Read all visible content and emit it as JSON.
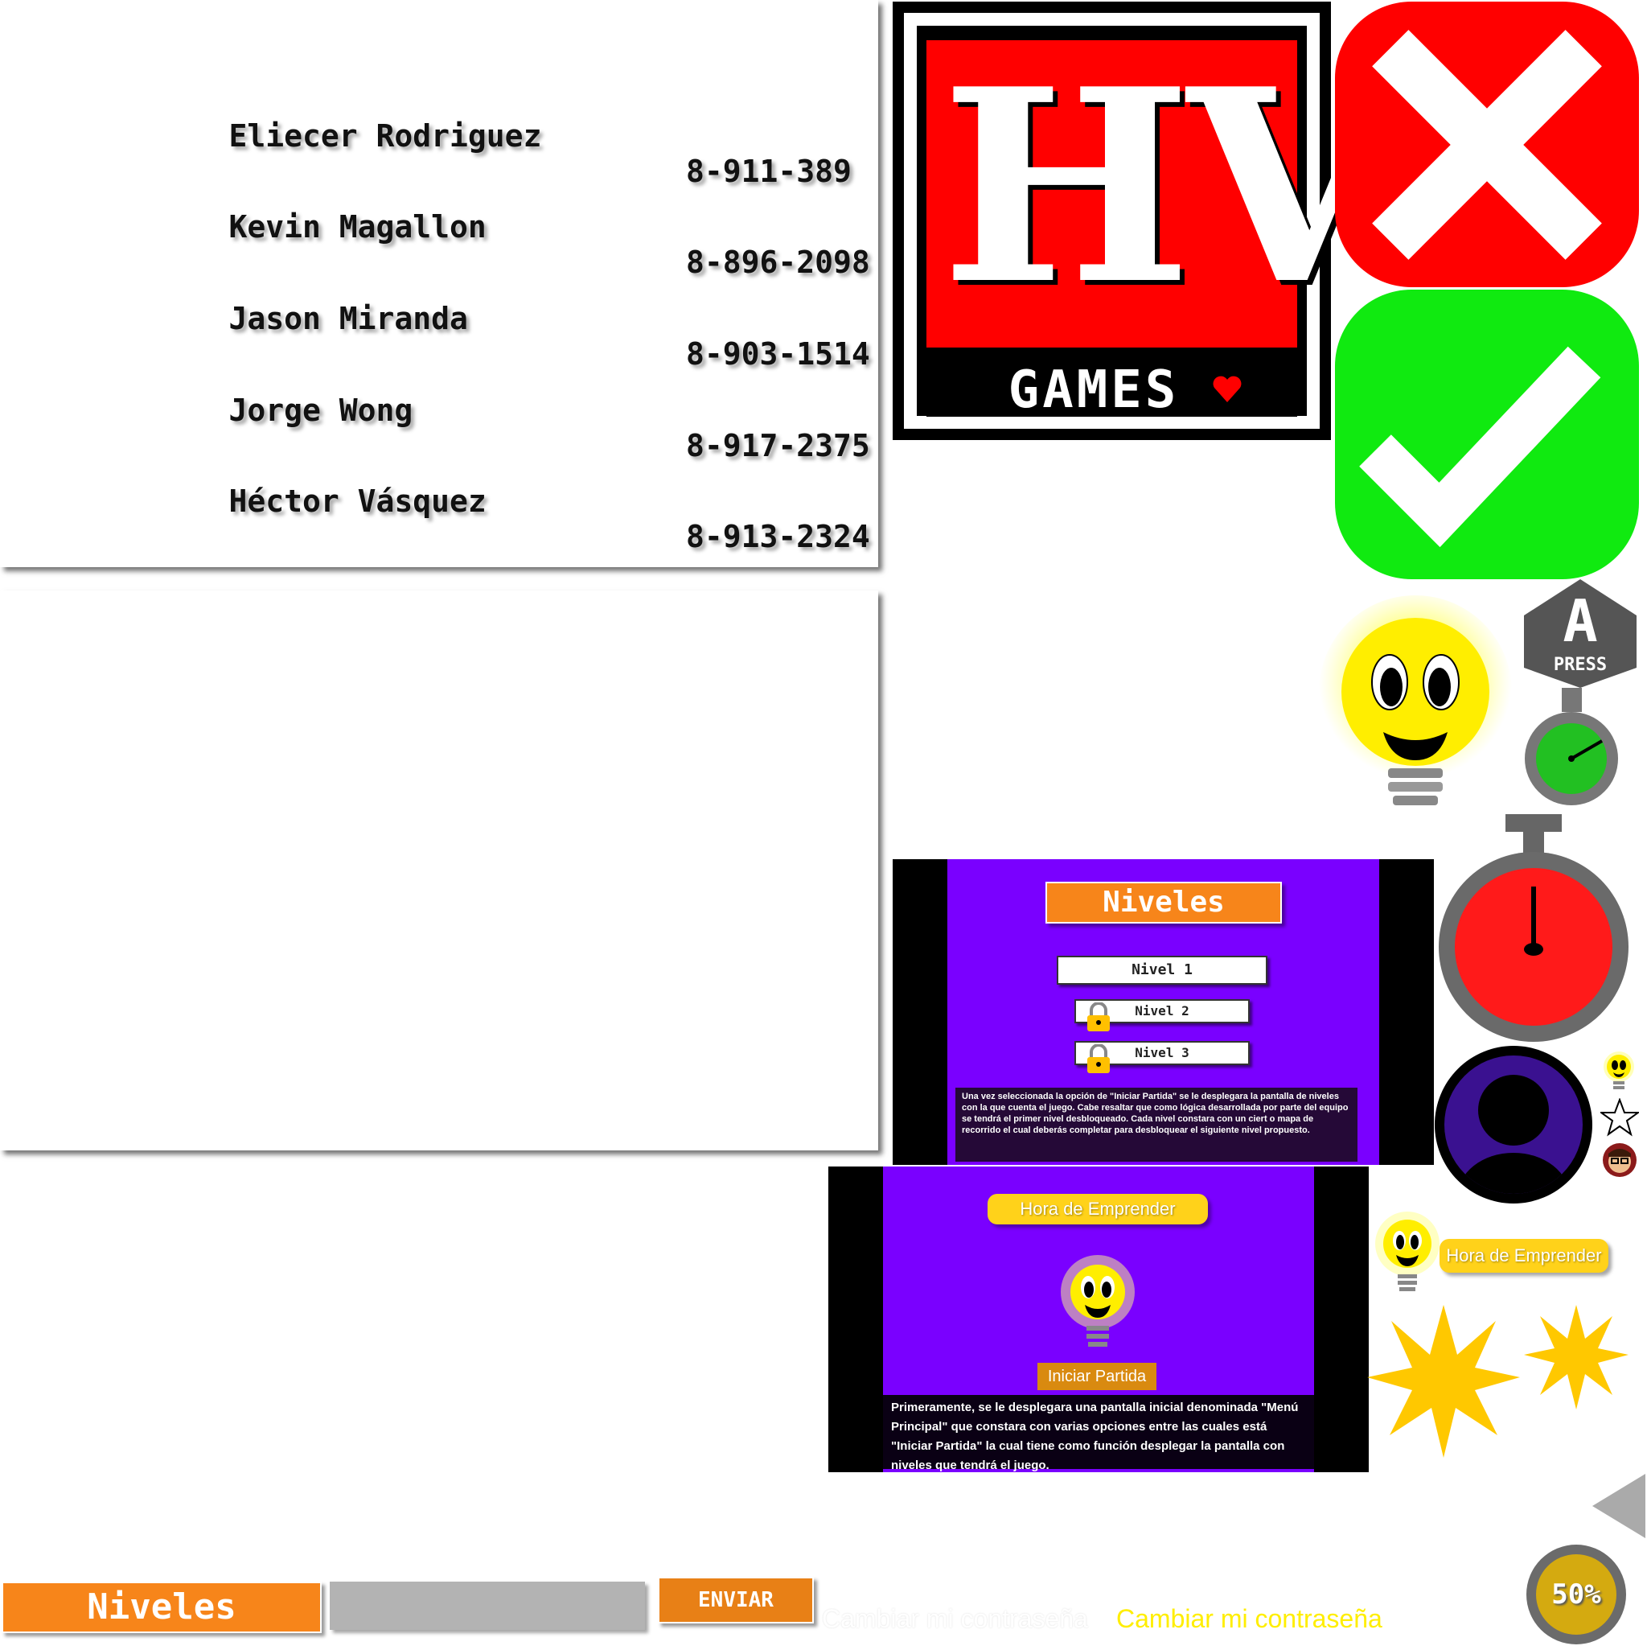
{
  "credits": [
    {
      "name": "Eliecer Rodriguez",
      "id": "8-911-389"
    },
    {
      "name": "Kevin Magallon",
      "id": "8-896-2098"
    },
    {
      "name": "Jason Miranda",
      "id": "8-903-1514"
    },
    {
      "name": "Jorge Wong",
      "id": "8-917-2375"
    },
    {
      "name": "Héctor Vásquez",
      "id": "8-913-2324"
    }
  ],
  "logo": {
    "letters": "HV",
    "subtitle": "GAMES"
  },
  "press_badge": {
    "letter": "A",
    "label": "PRESS"
  },
  "levels_screen": {
    "title": "Niveles",
    "levels": [
      "Nivel 1",
      "Nivel 2",
      "Nivel 3"
    ],
    "caption": "Una vez seleccionada la opción de \"Iniciar Partida\" se le desplegara la pantalla de niveles con la que cuenta el juego. Cabe resaltar que como lógica desarrollada por parte del equipo se tendrá el primer nivel desbloqueado. Cada nivel  constara con un ciert o mapa de recorrido el cual deberás completar para desbloquear el siguiente nivel propuesto."
  },
  "menu_screen": {
    "title": "Hora de Emprender",
    "start_button": "Iniciar Partida",
    "caption": "Primeramente, se le desplegara una pantalla inicial denominada \"Menú Principal\" que constara con varias opciones entre las cuales está \"Iniciar Partida\" la cual tiene como función desplegar la pantalla con niveles que tendrá el juego."
  },
  "banner": {
    "title": "Hora de Emprender"
  },
  "bottom": {
    "niveles_button": "Niveles",
    "enviar_button": "ENVIAR",
    "change_password_ghost": "Cambiar mi contraseña",
    "change_password": "Cambiar mi contraseña"
  },
  "progress": {
    "label": "50%",
    "value": 0.5
  },
  "colors": {
    "red": "#ff0000",
    "green": "#10ea10",
    "purple": "#7a00ff",
    "orange": "#f7851a",
    "yellow": "#ffd21a",
    "logo_red": "#ff0000"
  }
}
